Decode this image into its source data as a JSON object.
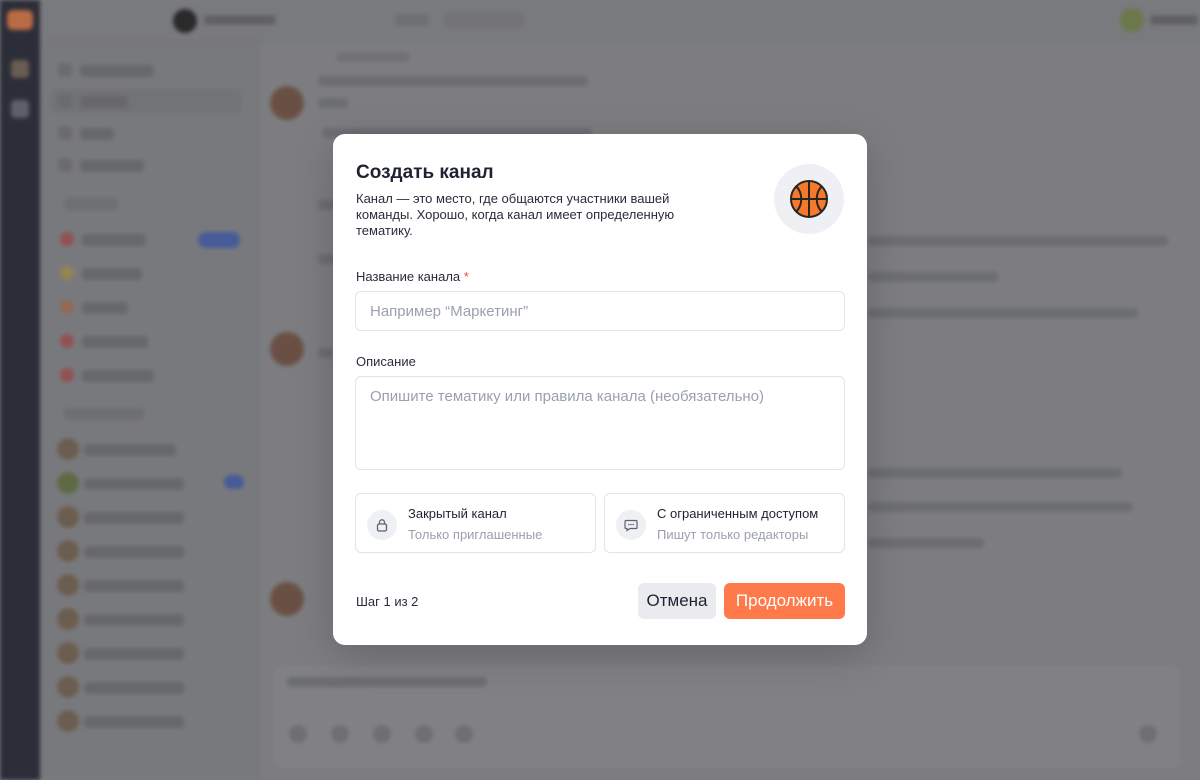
{
  "modal": {
    "title": "Создать канал",
    "subtitle": "Канал — это место, где общаются участники вашей команды. Хорошо, когда канал имеет определенную тематику.",
    "icon": "basketball-icon",
    "name_field": {
      "label": "Название канала",
      "required_mark": "*",
      "value": "",
      "placeholder": "Например “Маркетинг”"
    },
    "description_field": {
      "label": "Описание",
      "value": "",
      "placeholder": "Опишите тематику или правила канала (необязательно)"
    },
    "options": [
      {
        "icon": "lock-icon",
        "title": "Закрытый канал",
        "subtitle": "Только приглашенные"
      },
      {
        "icon": "chat-bubble-icon",
        "title": "С ограниченным доступом",
        "subtitle": "Пишут только редакторы"
      }
    ],
    "step": "Шаг 1 из 2",
    "cancel_label": "Отмена",
    "continue_label": "Продолжить"
  },
  "colors": {
    "accent": "#ff7a4a",
    "backdrop": "#7f8083",
    "sidebar_rail": "#1d1f2c",
    "title_text": "#1f2233",
    "placeholder_text": "#9aa0ad",
    "required": "#e8503a"
  }
}
